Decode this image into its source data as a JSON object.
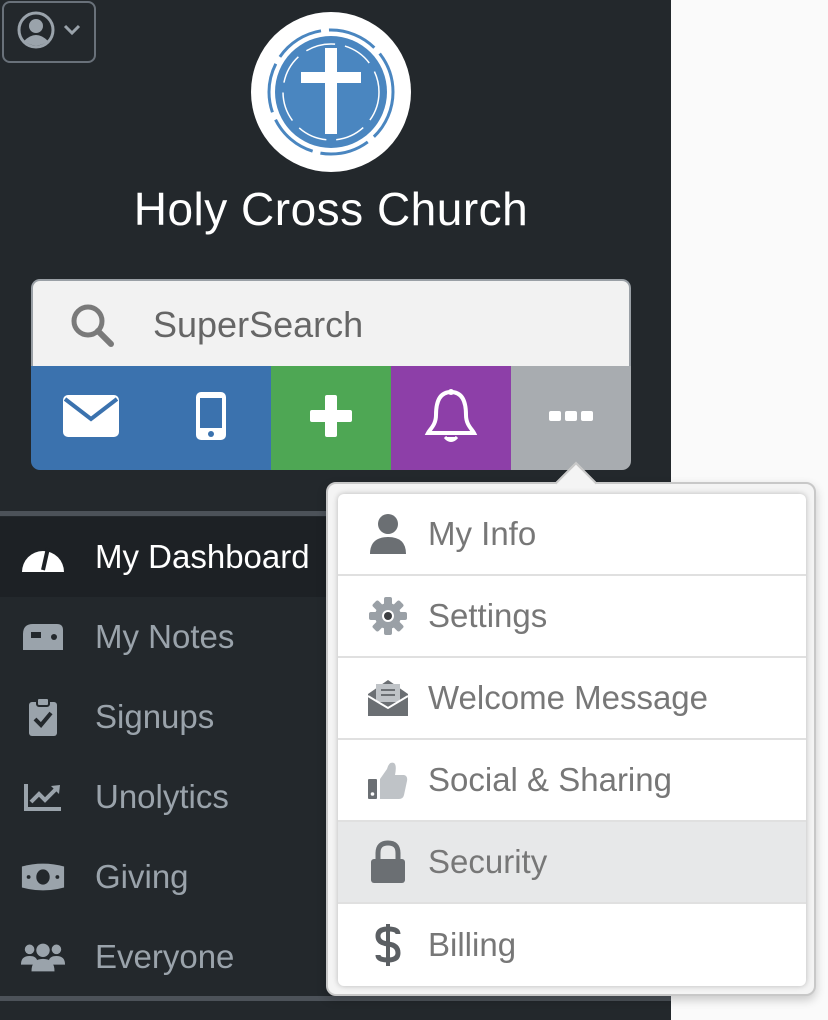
{
  "header": {
    "church_name": "Holy Cross Church",
    "user_menu_icon": "user-circle-icon"
  },
  "search": {
    "placeholder": "SuperSearch",
    "icon": "search-icon"
  },
  "action_bar": [
    {
      "name": "email",
      "icon": "envelope-icon",
      "color": "#3b72ae"
    },
    {
      "name": "text",
      "icon": "mobile-phone-icon",
      "color": "#3b72ae"
    },
    {
      "name": "add",
      "icon": "plus-icon",
      "color": "#4ea754"
    },
    {
      "name": "notifications",
      "icon": "bell-icon",
      "color": "#8d3fa8"
    },
    {
      "name": "more",
      "icon": "ellipsis-icon",
      "color": "#a8acb0"
    }
  ],
  "nav": {
    "items": [
      {
        "label": "My Dashboard",
        "icon": "dashboard-gauge-icon",
        "active": true
      },
      {
        "label": "My Notes",
        "icon": "mailbox-icon"
      },
      {
        "label": "Signups",
        "icon": "clipboard-check-icon"
      },
      {
        "label": "Unolytics",
        "icon": "chart-line-icon"
      },
      {
        "label": "Giving",
        "icon": "money-bill-icon"
      },
      {
        "label": "Everyone",
        "icon": "users-icon"
      }
    ]
  },
  "more_menu": {
    "items": [
      {
        "label": "My Info",
        "icon": "user-icon"
      },
      {
        "label": "Settings",
        "icon": "gear-icon"
      },
      {
        "label": "Welcome Message",
        "icon": "envelope-open-icon"
      },
      {
        "label": "Social & Sharing",
        "icon": "thumbs-up-icon"
      },
      {
        "label": "Security",
        "icon": "lock-icon",
        "highlighted": true
      },
      {
        "label": "Billing",
        "icon": "dollar-icon"
      }
    ]
  }
}
